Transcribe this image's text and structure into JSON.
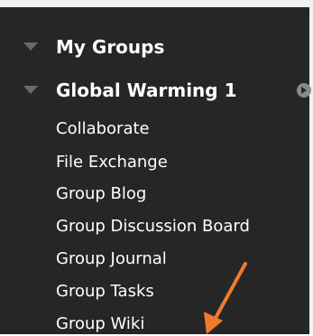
{
  "sections": {
    "my_groups": {
      "label": "My Groups"
    },
    "group": {
      "label": "Global Warming 1",
      "links": [
        {
          "label": "Collaborate"
        },
        {
          "label": "File Exchange"
        },
        {
          "label": "Group Blog"
        },
        {
          "label": "Group Discussion Board"
        },
        {
          "label": "Group Journal"
        },
        {
          "label": "Group Tasks"
        },
        {
          "label": "Group Wiki"
        }
      ]
    }
  },
  "icons": {
    "collapse": "triangle-down-icon",
    "group_options": "circle-arrow-right-icon",
    "annotation": "orange-arrow-icon"
  },
  "colors": {
    "panel_background": "#262626",
    "text": "#ffffff",
    "triangle": "#6b6b6b",
    "annotation_arrow": "#f07a2b"
  }
}
